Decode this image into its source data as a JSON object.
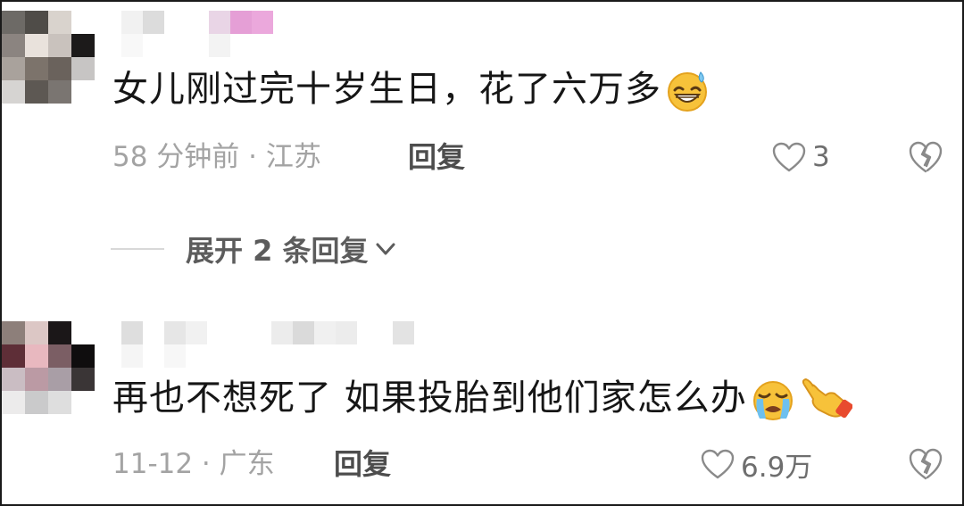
{
  "comments": [
    {
      "text": "女儿刚过完十岁生日，花了六万多",
      "emoji_icons": [
        "grinning-sweat-emoji"
      ],
      "meta": "58 分钟前 · 江苏",
      "reply_label": "回复",
      "likes": "3",
      "expand_label": "展开 2 条回复"
    },
    {
      "text": "再也不想死了 如果投胎到他们家怎么办",
      "emoji_icons": [
        "crying-face-emoji",
        "pointing-hand-emoji"
      ],
      "meta": "11-12 · 广东",
      "reply_label": "回复",
      "likes": "6.9万"
    }
  ],
  "icons": {
    "like": "heart-outline-icon",
    "dislike": "broken-heart-icon",
    "expand": "chevron-down-icon"
  },
  "colors": {
    "text": "#161616",
    "meta": "#a3a3a3",
    "reply": "#4d4d4d",
    "frame_border": "#1a1a1a"
  }
}
